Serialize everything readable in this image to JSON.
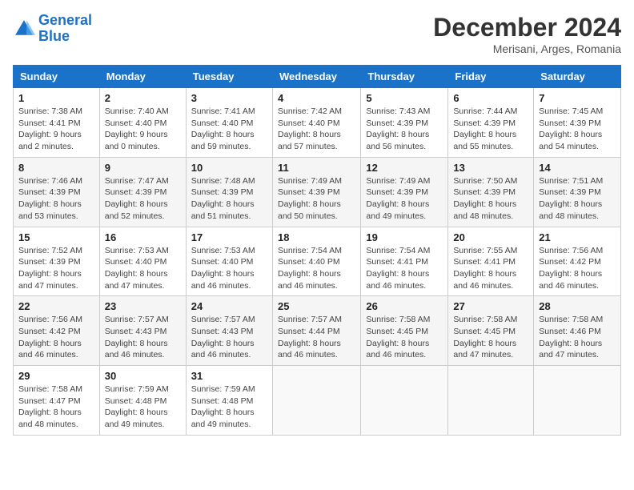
{
  "logo": {
    "line1": "General",
    "line2": "Blue"
  },
  "title": "December 2024",
  "subtitle": "Merisani, Arges, Romania",
  "days_header": [
    "Sunday",
    "Monday",
    "Tuesday",
    "Wednesday",
    "Thursday",
    "Friday",
    "Saturday"
  ],
  "weeks": [
    [
      {
        "num": "1",
        "sunrise": "7:38 AM",
        "sunset": "4:41 PM",
        "daylight": "9 hours and 2 minutes."
      },
      {
        "num": "2",
        "sunrise": "7:40 AM",
        "sunset": "4:40 PM",
        "daylight": "9 hours and 0 minutes."
      },
      {
        "num": "3",
        "sunrise": "7:41 AM",
        "sunset": "4:40 PM",
        "daylight": "8 hours and 59 minutes."
      },
      {
        "num": "4",
        "sunrise": "7:42 AM",
        "sunset": "4:40 PM",
        "daylight": "8 hours and 57 minutes."
      },
      {
        "num": "5",
        "sunrise": "7:43 AM",
        "sunset": "4:39 PM",
        "daylight": "8 hours and 56 minutes."
      },
      {
        "num": "6",
        "sunrise": "7:44 AM",
        "sunset": "4:39 PM",
        "daylight": "8 hours and 55 minutes."
      },
      {
        "num": "7",
        "sunrise": "7:45 AM",
        "sunset": "4:39 PM",
        "daylight": "8 hours and 54 minutes."
      }
    ],
    [
      {
        "num": "8",
        "sunrise": "7:46 AM",
        "sunset": "4:39 PM",
        "daylight": "8 hours and 53 minutes."
      },
      {
        "num": "9",
        "sunrise": "7:47 AM",
        "sunset": "4:39 PM",
        "daylight": "8 hours and 52 minutes."
      },
      {
        "num": "10",
        "sunrise": "7:48 AM",
        "sunset": "4:39 PM",
        "daylight": "8 hours and 51 minutes."
      },
      {
        "num": "11",
        "sunrise": "7:49 AM",
        "sunset": "4:39 PM",
        "daylight": "8 hours and 50 minutes."
      },
      {
        "num": "12",
        "sunrise": "7:49 AM",
        "sunset": "4:39 PM",
        "daylight": "8 hours and 49 minutes."
      },
      {
        "num": "13",
        "sunrise": "7:50 AM",
        "sunset": "4:39 PM",
        "daylight": "8 hours and 48 minutes."
      },
      {
        "num": "14",
        "sunrise": "7:51 AM",
        "sunset": "4:39 PM",
        "daylight": "8 hours and 48 minutes."
      }
    ],
    [
      {
        "num": "15",
        "sunrise": "7:52 AM",
        "sunset": "4:39 PM",
        "daylight": "8 hours and 47 minutes."
      },
      {
        "num": "16",
        "sunrise": "7:53 AM",
        "sunset": "4:40 PM",
        "daylight": "8 hours and 47 minutes."
      },
      {
        "num": "17",
        "sunrise": "7:53 AM",
        "sunset": "4:40 PM",
        "daylight": "8 hours and 46 minutes."
      },
      {
        "num": "18",
        "sunrise": "7:54 AM",
        "sunset": "4:40 PM",
        "daylight": "8 hours and 46 minutes."
      },
      {
        "num": "19",
        "sunrise": "7:54 AM",
        "sunset": "4:41 PM",
        "daylight": "8 hours and 46 minutes."
      },
      {
        "num": "20",
        "sunrise": "7:55 AM",
        "sunset": "4:41 PM",
        "daylight": "8 hours and 46 minutes."
      },
      {
        "num": "21",
        "sunrise": "7:56 AM",
        "sunset": "4:42 PM",
        "daylight": "8 hours and 46 minutes."
      }
    ],
    [
      {
        "num": "22",
        "sunrise": "7:56 AM",
        "sunset": "4:42 PM",
        "daylight": "8 hours and 46 minutes."
      },
      {
        "num": "23",
        "sunrise": "7:57 AM",
        "sunset": "4:43 PM",
        "daylight": "8 hours and 46 minutes."
      },
      {
        "num": "24",
        "sunrise": "7:57 AM",
        "sunset": "4:43 PM",
        "daylight": "8 hours and 46 minutes."
      },
      {
        "num": "25",
        "sunrise": "7:57 AM",
        "sunset": "4:44 PM",
        "daylight": "8 hours and 46 minutes."
      },
      {
        "num": "26",
        "sunrise": "7:58 AM",
        "sunset": "4:45 PM",
        "daylight": "8 hours and 46 minutes."
      },
      {
        "num": "27",
        "sunrise": "7:58 AM",
        "sunset": "4:45 PM",
        "daylight": "8 hours and 47 minutes."
      },
      {
        "num": "28",
        "sunrise": "7:58 AM",
        "sunset": "4:46 PM",
        "daylight": "8 hours and 47 minutes."
      }
    ],
    [
      {
        "num": "29",
        "sunrise": "7:58 AM",
        "sunset": "4:47 PM",
        "daylight": "8 hours and 48 minutes."
      },
      {
        "num": "30",
        "sunrise": "7:59 AM",
        "sunset": "4:48 PM",
        "daylight": "8 hours and 49 minutes."
      },
      {
        "num": "31",
        "sunrise": "7:59 AM",
        "sunset": "4:48 PM",
        "daylight": "8 hours and 49 minutes."
      },
      null,
      null,
      null,
      null
    ]
  ]
}
